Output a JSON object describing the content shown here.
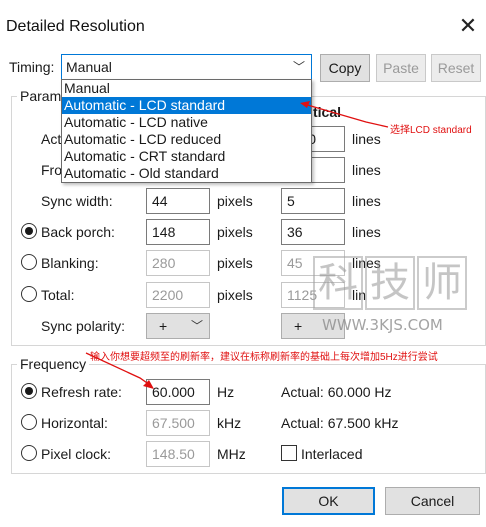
{
  "window": {
    "title": "Detailed Resolution"
  },
  "timing": {
    "label": "Timing:",
    "selected": "Manual",
    "options": [
      "Manual",
      "Automatic - LCD standard",
      "Automatic - LCD native",
      "Automatic - LCD reduced",
      "Automatic - CRT standard",
      "Automatic - Old standard"
    ],
    "copy": "Copy",
    "paste": "Paste",
    "reset": "Reset"
  },
  "params": {
    "group_label": "Param",
    "active_label_partial": "Act",
    "front_label_partial": "Fro",
    "vertical_header_partial": "tical",
    "active_v_partial": "0",
    "sync_width_label": "Sync width:",
    "back_porch_label": "Back porch:",
    "blanking_label": "Blanking:",
    "total_label": "Total:",
    "sync_polarity_label": "Sync polarity:",
    "h": {
      "sync_width": "44",
      "back_porch": "148",
      "blanking": "280",
      "total": "2200",
      "polarity": "+"
    },
    "v": {
      "sync_width": "5",
      "back_porch": "36",
      "blanking": "45",
      "total_partial": "1125",
      "polarity": "+"
    },
    "unit_pixels": "pixels",
    "unit_lines": "lines",
    "unit_lines_partial": "lin"
  },
  "frequency": {
    "group_label": "Frequency",
    "refresh_label": "Refresh rate:",
    "refresh_value": "60.000",
    "refresh_unit": "Hz",
    "refresh_actual": "Actual: 60.000 Hz",
    "horizontal_label": "Horizontal:",
    "horizontal_value": "67.500",
    "horizontal_unit": "kHz",
    "horizontal_actual": "Actual: 67.500 kHz",
    "pixel_clock_label": "Pixel clock:",
    "pixel_clock_value": "148.50",
    "pixel_clock_unit": "MHz",
    "interlaced_label": "Interlaced"
  },
  "buttons": {
    "ok": "OK",
    "cancel": "Cancel"
  },
  "annotations": {
    "select_note": "选择LCD standard",
    "refresh_note": "输入你想要超频至的刷新率，建议在标称刷新率的基础上每次增加5Hz进行尝试"
  },
  "watermark": {
    "chars": [
      "科",
      "技",
      "师"
    ],
    "url": "WWW.3KJS.COM"
  },
  "colors": {
    "accent": "#0078d7",
    "annotation": "#e01010"
  }
}
